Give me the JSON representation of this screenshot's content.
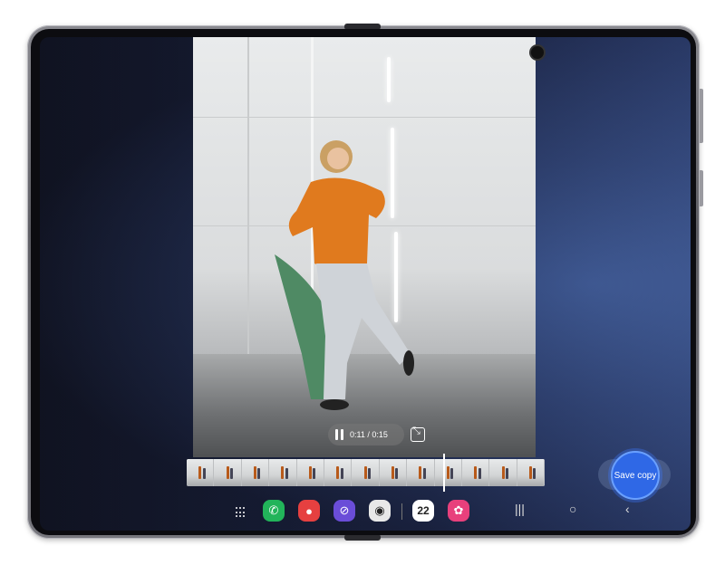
{
  "player": {
    "time": "0:11 / 0:15",
    "timeline_frames": 13
  },
  "actions": {
    "save_copy_label": "Save copy"
  },
  "taskbar": {
    "calendar_date": "22",
    "apps": [
      {
        "name": "phone",
        "color": "#22b45a"
      },
      {
        "name": "contacts",
        "color": "#e64040"
      },
      {
        "name": "internet",
        "color": "#6a4dd8"
      },
      {
        "name": "camera",
        "color": "#e8e8e8"
      },
      {
        "name": "calendar",
        "color": "#ffffff"
      },
      {
        "name": "gallery",
        "color": "#e8407c"
      }
    ]
  },
  "colors": {
    "accent": "#2f68e6",
    "jacket": "#e07a1e"
  }
}
